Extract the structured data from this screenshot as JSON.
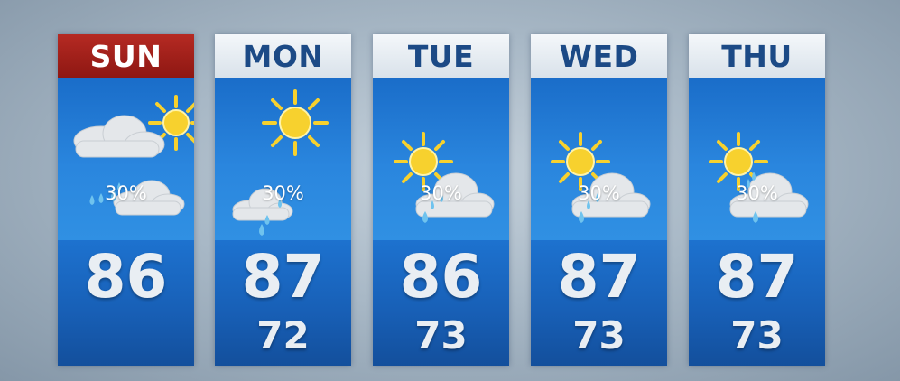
{
  "days": [
    {
      "day": "SUN",
      "precip": "30%",
      "high": "86",
      "low": "",
      "today": true,
      "icon": "sun-cloud-rain-icon"
    },
    {
      "day": "MON",
      "precip": "30%",
      "high": "87",
      "low": "72",
      "today": false,
      "icon": "sun-cloud-rain-icon"
    },
    {
      "day": "TUE",
      "precip": "30%",
      "high": "86",
      "low": "73",
      "today": false,
      "icon": "sun-cloud-rain-icon"
    },
    {
      "day": "WED",
      "precip": "30%",
      "high": "87",
      "low": "73",
      "today": false,
      "icon": "sun-cloud-rain-icon"
    },
    {
      "day": "THU",
      "precip": "30%",
      "high": "87",
      "low": "73",
      "today": false,
      "icon": "sun-cloud-rain-icon"
    }
  ],
  "colors": {
    "today_header": "#a0201a",
    "header": "#e6ecf1",
    "header_text": "#1c4a86",
    "panel": "#1d6fcc",
    "sun": "#f7d12e",
    "cloud": "#e4e7ea",
    "rain": "#6fc3ee"
  }
}
